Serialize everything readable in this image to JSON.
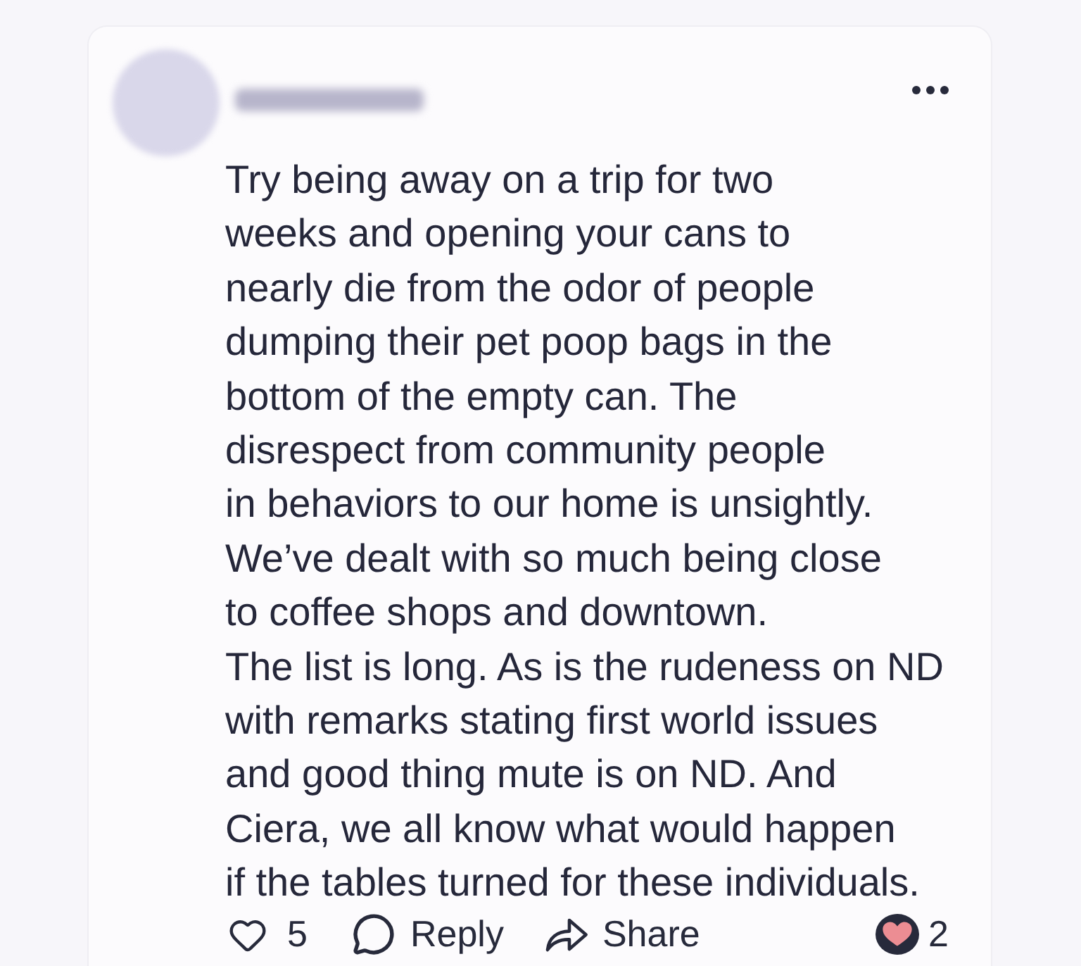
{
  "post": {
    "body": "Try being away on a trip for two\nweeks and opening your cans to\nnearly die from the odor of people\ndumping their pet poop bags in the\nbottom of the empty can. The\ndisrespect from community people\nin behaviors to our home is unsightly.\nWe’ve dealt with so much being close\nto coffee shops and downtown.\nThe list is long. As is the rudeness on ND\nwith remarks stating first world issues\nand good thing mute is on ND. And\nCiera, we all know what would happen\nif the tables turned for these individuals.",
    "actions": [
      {
        "kind": "like",
        "label": "5",
        "selected": false
      },
      {
        "kind": "reply",
        "label": "Reply"
      },
      {
        "kind": "share",
        "label": "Share"
      }
    ],
    "reactions": {
      "count": "2"
    }
  }
}
